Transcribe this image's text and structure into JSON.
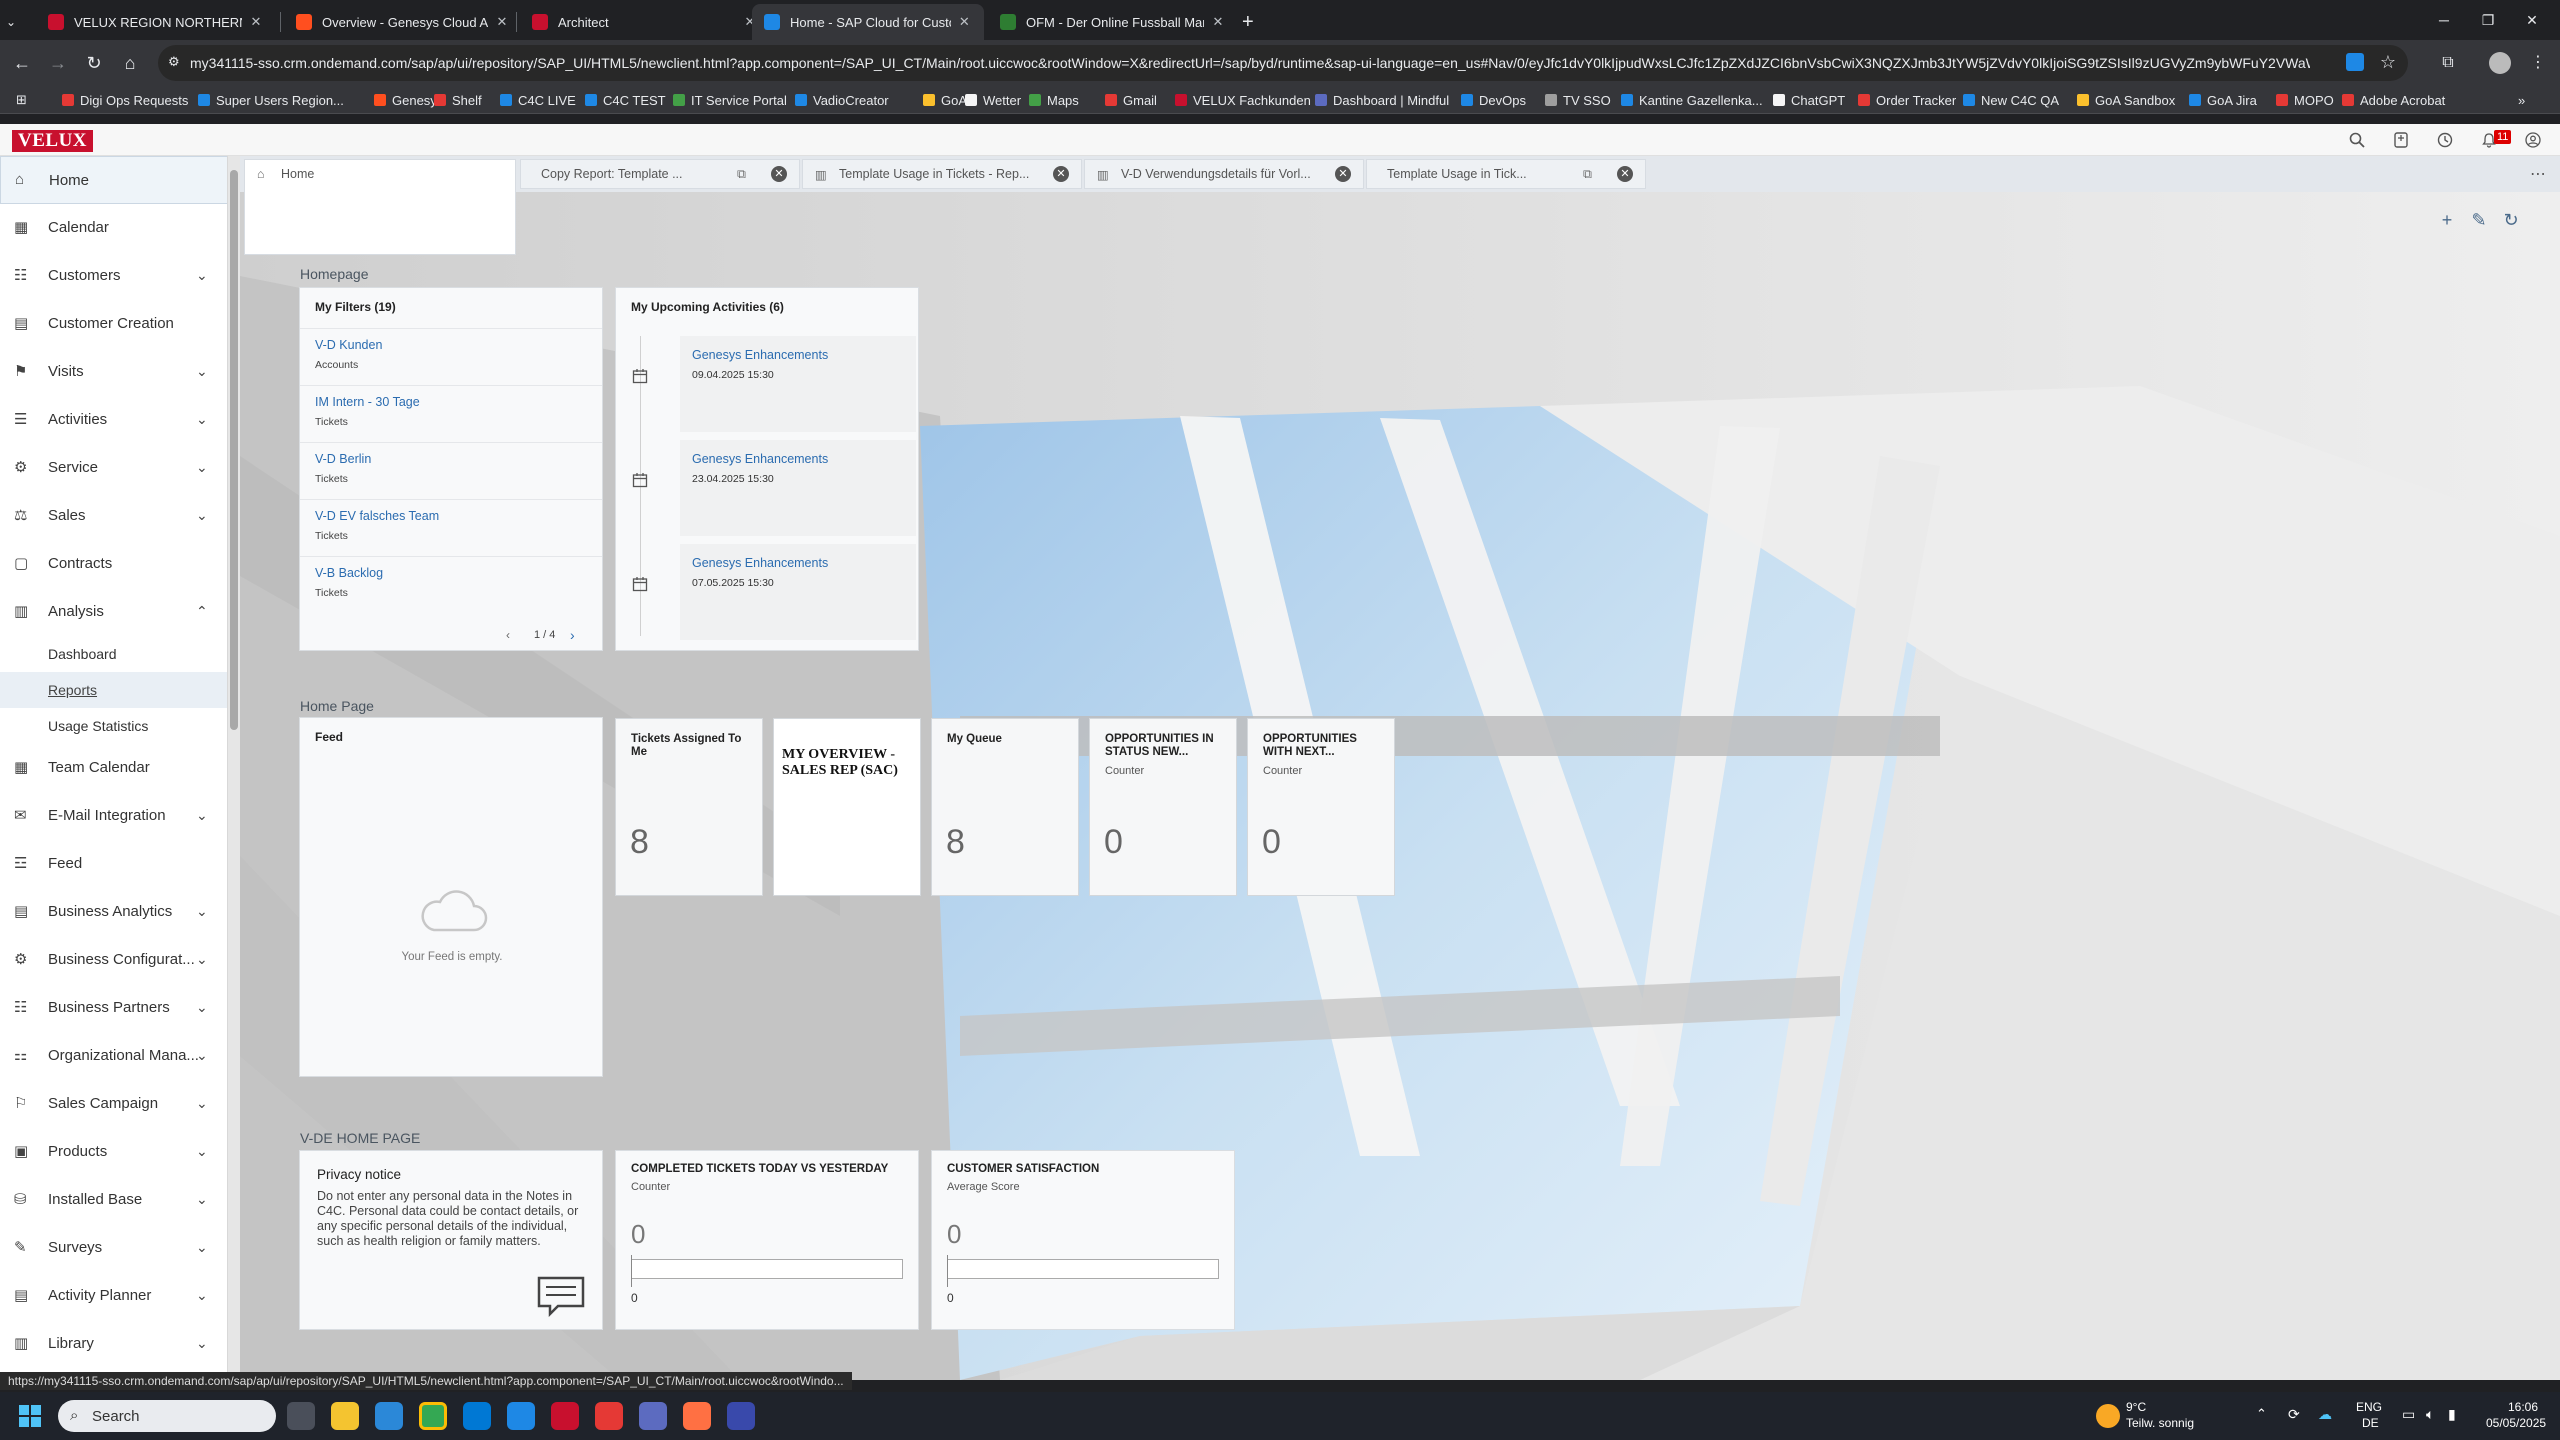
{
  "browser": {
    "tabs": [
      {
        "title": "VELUX REGION NORTHERN EU",
        "color": "#c8102e"
      },
      {
        "title": "Overview - Genesys Cloud Adm",
        "color": "#ff4f1f"
      },
      {
        "title": "Architect",
        "color": "#c8102e"
      },
      {
        "title": "Home - SAP Cloud for Custome",
        "color": "#1e88e5"
      },
      {
        "title": "OFM - Der Online Fussball Man",
        "color": "#2e7d32"
      }
    ],
    "url": "my341115-sso.crm.ondemand.com/sap/ap/ui/repository/SAP_UI/HTML5/newclient.html?app.component=/SAP_UI_CT/Main/root.uiccwoc&rootWindow=X&redirectUrl=/sap/byd/runtime&sap-ui-language=en_us#Nav/0/eyJfc1dvY0lkIjpudWxsLCJfc1ZpZXdJZCI6bnVsbCwiX3NQZXJmb3JtYW5jZVdvY0lkIjoiSG9tZSIsIl9zUGVyZm9ybWFuY2VWaWV3S..."
  },
  "bookmarks": [
    {
      "label": "Digi Ops Requests",
      "color": "#e53935"
    },
    {
      "label": "Super Users Region...",
      "color": "#1e88e5"
    },
    {
      "label": "Genesys",
      "color": "#ff4f1f"
    },
    {
      "label": "Shelf",
      "color": "#e53935"
    },
    {
      "label": "C4C LIVE",
      "color": "#1e88e5"
    },
    {
      "label": "C4C TEST",
      "color": "#1e88e5"
    },
    {
      "label": "IT Service Portal",
      "color": "#43a047"
    },
    {
      "label": "VadioCreator",
      "color": "#1e88e5"
    },
    {
      "label": "GoA",
      "color": "#fbc02d"
    },
    {
      "label": "Wetter",
      "color": "#f5f5f5"
    },
    {
      "label": "Maps",
      "color": "#43a047"
    },
    {
      "label": "Gmail",
      "color": "#e53935"
    },
    {
      "label": "VELUX Fachkunden",
      "color": "#c8102e"
    },
    {
      "label": "Dashboard | Mindful",
      "color": "#5c6bc0"
    },
    {
      "label": "DevOps",
      "color": "#1e88e5"
    },
    {
      "label": "TV SSO",
      "color": "#9e9e9e"
    },
    {
      "label": "Kantine Gazellenka...",
      "color": "#1e88e5"
    },
    {
      "label": "ChatGPT",
      "color": "#f5f5f5"
    },
    {
      "label": "Order Tracker",
      "color": "#e53935"
    },
    {
      "label": "New C4C QA",
      "color": "#1e88e5"
    },
    {
      "label": "GoA Sandbox",
      "color": "#fbc02d"
    },
    {
      "label": "GoA Jira",
      "color": "#1e88e5"
    },
    {
      "label": "MOPO",
      "color": "#e53935"
    },
    {
      "label": "Adobe Acrobat",
      "color": "#e53935"
    }
  ],
  "sap": {
    "logo": "VELUX",
    "notifications": "11"
  },
  "sidebar": {
    "items": [
      {
        "label": "Home",
        "icon": "home-icon"
      },
      {
        "label": "Calendar",
        "icon": "calendar-icon"
      },
      {
        "label": "Customers",
        "icon": "customers-icon"
      },
      {
        "label": "Customer Creation",
        "icon": "document-icon"
      },
      {
        "label": "Visits",
        "icon": "visits-icon"
      },
      {
        "label": "Activities",
        "icon": "activities-icon"
      },
      {
        "label": "Service",
        "icon": "service-icon"
      },
      {
        "label": "Sales",
        "icon": "sales-icon"
      },
      {
        "label": "Contracts",
        "icon": "contracts-icon"
      },
      {
        "label": "Analysis",
        "icon": "analysis-icon"
      },
      {
        "label": "Team Calendar",
        "icon": "team-calendar-icon"
      },
      {
        "label": "E-Mail Integration",
        "icon": "email-icon"
      },
      {
        "label": "Feed",
        "icon": "feed-icon"
      },
      {
        "label": "Business Analytics",
        "icon": "business-analytics-icon"
      },
      {
        "label": "Business Configurat...",
        "icon": "configuration-icon"
      },
      {
        "label": "Business Partners",
        "icon": "partners-icon"
      },
      {
        "label": "Organizational Mana...",
        "icon": "organization-icon"
      },
      {
        "label": "Sales Campaign",
        "icon": "campaign-icon"
      },
      {
        "label": "Products",
        "icon": "products-icon"
      },
      {
        "label": "Installed Base",
        "icon": "installed-base-icon"
      },
      {
        "label": "Surveys",
        "icon": "surveys-icon"
      },
      {
        "label": "Activity Planner",
        "icon": "activity-planner-icon"
      },
      {
        "label": "Library",
        "icon": "library-icon"
      }
    ],
    "analysis_sub": [
      "Dashboard",
      "Reports",
      "Usage Statistics"
    ]
  },
  "app_tabs": [
    {
      "label": "Home"
    },
    {
      "label": "Copy Report: Template ..."
    },
    {
      "label": "Template Usage in Tickets - Rep..."
    },
    {
      "label": "V-D Verwendungsdetails für Vorl..."
    },
    {
      "label": "Template Usage in Tick..."
    }
  ],
  "sections": {
    "homepage": "Homepage",
    "home_page": "Home Page",
    "vde": "V-DE HOME PAGE"
  },
  "filters": {
    "title": "My Filters (19)",
    "items": [
      {
        "name": "V-D Kunden",
        "type": "Accounts"
      },
      {
        "name": "IM Intern - 30 Tage",
        "type": "Tickets"
      },
      {
        "name": "V-D Berlin",
        "type": "Tickets"
      },
      {
        "name": "V-D EV falsches Team",
        "type": "Tickets"
      },
      {
        "name": "V-B Backlog",
        "type": "Tickets"
      }
    ],
    "pager": "1 / 4"
  },
  "activities": {
    "title": "My Upcoming Activities (6)",
    "items": [
      {
        "name": "Genesys Enhancements",
        "date": "09.04.2025 15:30"
      },
      {
        "name": "Genesys Enhancements",
        "date": "23.04.2025 15:30"
      },
      {
        "name": "Genesys Enhancements",
        "date": "07.05.2025 15:30"
      }
    ]
  },
  "feed": {
    "title": "Feed",
    "empty": "Your Feed is empty."
  },
  "tiles": [
    {
      "title": "Tickets Assigned To Me",
      "sub": "",
      "value": "8"
    },
    {
      "title": "MY OVERVIEW - SALES REP (SAC)",
      "sub": "",
      "value": ""
    },
    {
      "title": "My Queue",
      "sub": "",
      "value": "8"
    },
    {
      "title": "OPPORTUNITIES IN STATUS NEW...",
      "sub": "Counter",
      "value": "0"
    },
    {
      "title": "OPPORTUNITIES WITH NEXT...",
      "sub": "Counter",
      "value": "0"
    }
  ],
  "privacy": {
    "title": "Privacy notice",
    "text": "Do not enter any personal data in the Notes in C4C. Personal data could be contact details, or any specific personal details of the individual, such as health religion or family matters."
  },
  "completed": {
    "title": "COMPLETED TICKETS TODAY VS YESTERDAY",
    "sub": "Counter",
    "value": "0",
    "axis": "0"
  },
  "satisfaction": {
    "title": "CUSTOMER SATISFACTION",
    "sub": "Average Score",
    "value": "0",
    "axis": "0"
  },
  "status_url": "https://my341115-sso.crm.ondemand.com/sap/ap/ui/repository/SAP_UI/HTML5/newclient.html?app.component=/SAP_UI_CT/Main/root.uiccwoc&rootWindo...",
  "taskbar": {
    "search": "Search",
    "weather_temp": "9°C",
    "weather_text": "Teilw. sonnig",
    "lang1": "ENG",
    "lang2": "DE",
    "time": "16:06",
    "date": "05/05/2025"
  }
}
